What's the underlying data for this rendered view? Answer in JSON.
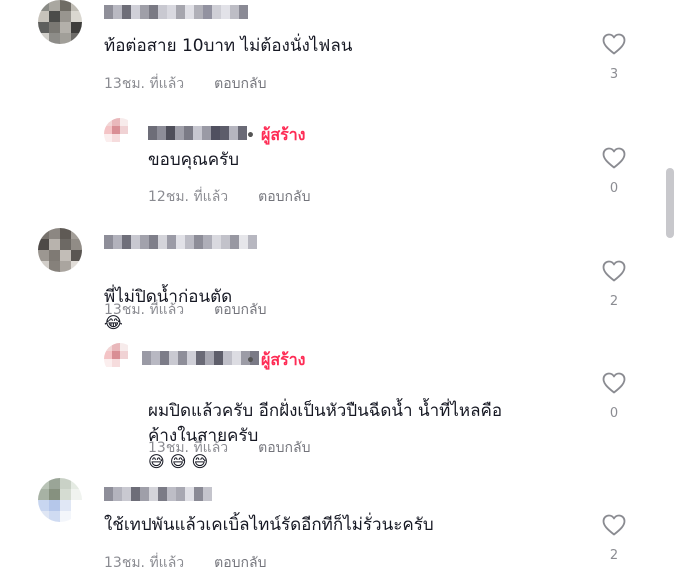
{
  "comments": [
    {
      "text": "ท้อต่อสาย 10บาท ไม่ต้องนั่งไฟลน",
      "time": "13ชม. ที่แล้ว",
      "reply": "ตอบกลับ",
      "likes": "3",
      "avatar_colors": [
        "#8a8b86",
        "#a9a7a0",
        "#6f6c65",
        "#bfbcb4",
        "#c7c3bb",
        "#4b4c4a",
        "#98958f",
        "#dad7d0",
        "#5e5f5d",
        "#7a7873",
        "#b3b0aa",
        "#3e3d3b",
        "#d1cfca",
        "#8d8c88",
        "#a19f99",
        "#6d6b68"
      ],
      "username_colors": [
        "#8f8f99",
        "#b9b9c2",
        "#6e6e78",
        "#d0d0d8",
        "#9f9fa8",
        "#7a7a84",
        "#c9c9d1",
        "#d9d9e0",
        "#a6a6ae",
        "#e0e0e6",
        "#b0b0b8",
        "#9292a0",
        "#cfcfd6",
        "#e2e2e8",
        "#bdbdc5",
        "#8a8a95"
      ]
    },
    {
      "text": "ขอบคุณครับ",
      "time": "12ชม. ที่แล้ว",
      "reply": "ตอบกลับ",
      "likes": "0",
      "creator_label": "ผู้สร้าง",
      "avatar_colors": [
        "#f2d6d6",
        "#e9b8bb",
        "#f7ebeb",
        "#ffffff",
        "#f4c4c6",
        "#d98f95",
        "#f0d2d4",
        "#ffffff",
        "#fbeeee",
        "#f6dcdd",
        "#ffffff",
        "#ffffff",
        "#ffffff",
        "#ffffff",
        "#ffffff",
        "#ffffff"
      ],
      "username_colors": [
        "#6d6d78",
        "#8d8d98",
        "#4f4f5a",
        "#a0a0aa",
        "#7b7b86",
        "#c7c7d0",
        "#9a9aa5",
        "#505060",
        "#5d5d6a",
        "#b5b5bf",
        "#6a6a76"
      ]
    },
    {
      "text": "พี่ไม่ปิดน้ำก่อนตัด",
      "emoji": "😂",
      "time": "13ชม. ที่แล้ว",
      "reply": "ตอบกลับ",
      "likes": "2",
      "avatar_colors": [
        "#77726d",
        "#8c8782",
        "#5f5a55",
        "#a39e98",
        "#4e4a47",
        "#b8b3ad",
        "#6d6964",
        "#918c86",
        "#9c9791",
        "#7f7a74",
        "#c2bdb7",
        "#5a5652",
        "#d2cec9",
        "#86817b",
        "#aaa59f",
        "#e1ddd8"
      ],
      "username_colors": [
        "#8e8e99",
        "#b2b2bc",
        "#6f6f7a",
        "#c8c8d0",
        "#a2a2ac",
        "#7f7f8a",
        "#d4d4da",
        "#9b9ba6",
        "#e1e1e7",
        "#bcbcc5",
        "#8d8d98",
        "#aeaeb8",
        "#d9d9df",
        "#c2c2ca",
        "#9898a2",
        "#e6e6ea",
        "#b7b7c0"
      ]
    },
    {
      "text": "ผมปิดแล้วครับ อีกฝั่งเป็นหัวปืนฉีดน้ำ น้ำที่ไหลคือ\nค้างในสายครับ",
      "emoji": "😅 😅 😅",
      "time": "13ชม. ที่แล้ว",
      "reply": "ตอบกลับ",
      "likes": "0",
      "creator_label": "ผู้สร้าง",
      "avatar_colors": [
        "#f2d6d6",
        "#e9b8bb",
        "#f7ebeb",
        "#ffffff",
        "#f4c4c6",
        "#d98f95",
        "#f0d2d4",
        "#ffffff",
        "#fbeeee",
        "#f6dcdd",
        "#ffffff",
        "#ffffff",
        "#ffffff",
        "#ffffff",
        "#ffffff",
        "#ffffff"
      ],
      "username_colors": [
        "#9a9aa5",
        "#b8b8c2",
        "#7c7c88",
        "#c9c9d1",
        "#8e8e99",
        "#d0d0d8",
        "#6a6a76",
        "#a7a7b1",
        "#5e5e6a",
        "#bfbfc8",
        "#dcdce2",
        "#9c9ca6",
        "#7a7a86"
      ]
    },
    {
      "text": "ใช้เทปพันแล้วเคเบิ้ลไทน์รัดอีกทีก็ไม่รั่วนะครับ",
      "time": "13ชม. ที่แล้ว",
      "reply": "ตอบกลับ",
      "likes": "2",
      "avatar_colors": [
        "#b9c3b6",
        "#9aa597",
        "#c9d1c6",
        "#e5ebe3",
        "#a7b2a4",
        "#86917f",
        "#d5dcd2",
        "#f0f3ef",
        "#c8d6f0",
        "#b5c7ea",
        "#e0e7f5",
        "#ffffff",
        "#dfe6f4",
        "#cfdbf2",
        "#f3f6fb",
        "#ffffff"
      ],
      "username_colors": [
        "#8e8e99",
        "#b3b3bd",
        "#c9c9d1",
        "#6d6d78",
        "#9f9fa9",
        "#d4d4da",
        "#7b7b86",
        "#bdbdc6",
        "#a8a8b2",
        "#e0e0e6",
        "#8a8a95",
        "#c4c4cc"
      ]
    }
  ],
  "icons": {
    "like": "heart-outline-icon"
  },
  "colors": {
    "creator": "#fe2c55",
    "text": "#161823",
    "meta": "#8a8b91"
  }
}
